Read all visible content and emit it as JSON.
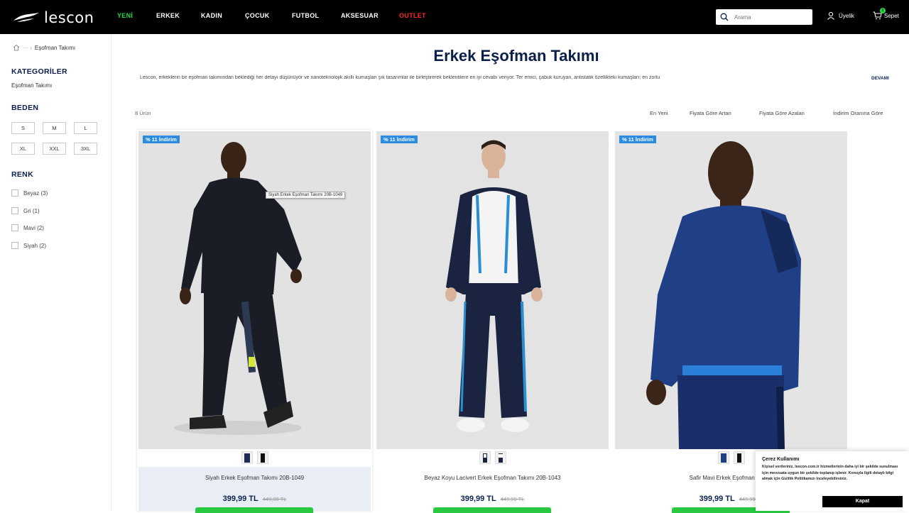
{
  "brand": {
    "name": "lescon"
  },
  "nav": {
    "items": [
      "YENİ",
      "ERKEK",
      "KADIN",
      "ÇOCUK",
      "FUTBOL",
      "AKSESUAR",
      "OUTLET"
    ]
  },
  "header": {
    "search_placeholder": "Arama",
    "account_label": "Üyelik",
    "cart_label": "Sepet",
    "cart_count": "0"
  },
  "breadcrumb": {
    "current": "Eşofman Takımı",
    "separator": "··· ›"
  },
  "sidebar": {
    "categories_title": "KATEGORİLER",
    "category_item": "Eşofman Takımı",
    "size_title": "BEDEN",
    "sizes": [
      "S",
      "M",
      "L",
      "XL",
      "XXL",
      "3XL"
    ],
    "color_title": "RENK",
    "colors": [
      "Beyaz (3)",
      "Gri (1)",
      "Mavi (2)",
      "Siyah (2)"
    ]
  },
  "main": {
    "title": "Erkek Eşofman Takımı",
    "description": "Lescon, erkeklerin bir eşofman takımından beklediği her detayı düşünüyor ve nanoteknolojik akıllı kumaşları şık tasarımlar ile birleştirerek beklentilere en iyi cevabı veriyor. Ter emici, çabuk kuruyan, antistatik özellikteki kumaşları; en zorlu",
    "more_label": "DEVAMI",
    "count_label": "8 Ürün",
    "sort_options": [
      "En Yeni",
      "Fiyata Göre Artan",
      "Fiyata Göre Azalan",
      "İndirim Oranına Göre"
    ]
  },
  "products": [
    {
      "badge": "% 11 İndirim",
      "name": "Siyah Erkek Eşofman Takımı 20B-1049",
      "price": "399,99 TL",
      "old_price": "449,99 TL",
      "tooltip": "Siyah Erkek Eşofman Takımı 20B-1049"
    },
    {
      "badge": "% 11 İndirim",
      "name": "Beyaz Koyu Lacivert Erkek Eşofman Takımı 20B-1043",
      "price": "399,99 TL",
      "old_price": "449,99 TL"
    },
    {
      "badge": "% 11 İndirim",
      "name": "Safir Mavi Erkek Eşofman Takımı",
      "price": "399,99 TL",
      "old_price": "449,99 TL"
    }
  ],
  "cookie": {
    "title": "Çerez Kullanımı",
    "text": "Kişisel verileriniz, lescon.com.tr hizmetlerinin daha iyi bir şekilde sunulması için mevzuata uygun bir şekilde toplanıp işlenir. Konuyla ilgili detaylı bilgi almak için Gizlilik Politikamızı inceleyebilirsiniz.",
    "button": "Kapat"
  },
  "colors": {
    "nav_bg": "#000000",
    "accent_green": "#28d64a",
    "outlet_red": "#ff2a2a",
    "title_navy": "#0b1f4a",
    "badge_blue": "#2b8be0"
  }
}
